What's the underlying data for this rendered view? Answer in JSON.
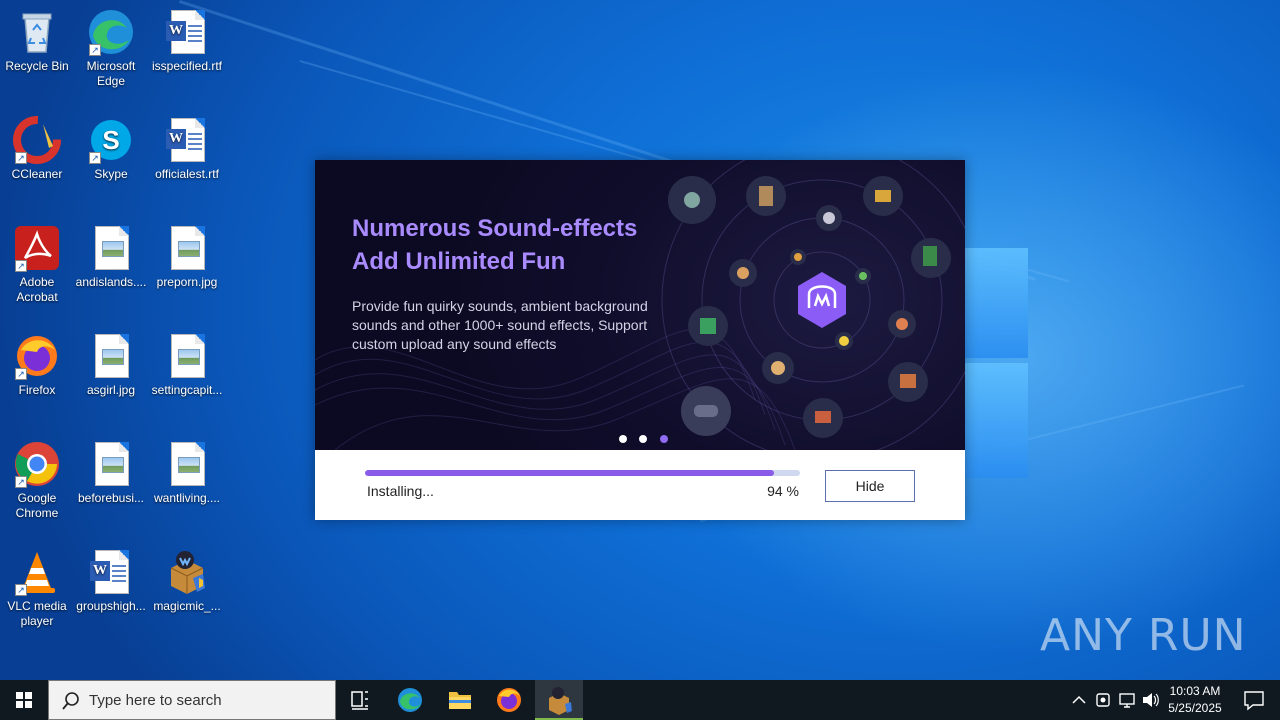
{
  "desktop": {
    "icons": [
      {
        "label": "Recycle Bin",
        "name": "recycle-bin"
      },
      {
        "label": "Microsoft Edge",
        "name": "microsoft-edge"
      },
      {
        "label": "isspecified.rtf",
        "name": "isspecified-rtf"
      },
      {
        "label": "CCleaner",
        "name": "ccleaner"
      },
      {
        "label": "Skype",
        "name": "skype"
      },
      {
        "label": "officialest.rtf",
        "name": "officialest-rtf"
      },
      {
        "label": "Adobe Acrobat",
        "name": "adobe-acrobat"
      },
      {
        "label": "andislands....",
        "name": "andislands-jpg"
      },
      {
        "label": "preporn.jpg",
        "name": "preporn-jpg"
      },
      {
        "label": "Firefox",
        "name": "firefox"
      },
      {
        "label": "asgirl.jpg",
        "name": "asgirl-jpg"
      },
      {
        "label": "settingcapit...",
        "name": "settingcapit-jpg"
      },
      {
        "label": "Google Chrome",
        "name": "google-chrome"
      },
      {
        "label": "beforebusi...",
        "name": "beforebusi-jpg"
      },
      {
        "label": "wantliving....",
        "name": "wantliving-jpg"
      },
      {
        "label": "VLC media player",
        "name": "vlc-media-player"
      },
      {
        "label": "groupshigh...",
        "name": "groupshigh-rtf"
      },
      {
        "label": "magicmic_...",
        "name": "magicmic-installer"
      }
    ]
  },
  "installer": {
    "banner": {
      "title_line1": "Numerous Sound-effects",
      "title_line2": "Add Unlimited Fun",
      "description": "Provide fun quirky sounds, ambient background sounds and other 1000+ sound effects, Support custom upload any sound effects",
      "slide_count": 3,
      "active_slide": 3
    },
    "progress": {
      "status": "Installing...",
      "percent_label": "94 %",
      "value": 0.94
    },
    "hide_label": "Hide"
  },
  "watermark": {
    "text": "ANY RUN"
  },
  "taskbar": {
    "search_placeholder": "Type here to search",
    "apps": [
      "task-view",
      "microsoft-edge",
      "file-explorer",
      "firefox",
      "magicmic-installer"
    ],
    "active_app": "magicmic-installer",
    "clock_time": "10:03 AM",
    "clock_date": "5/25/2025"
  },
  "colors": {
    "accent_purple": "#8a5ae8",
    "banner_title": "#a98bff",
    "taskbar_bg": "#101820"
  }
}
